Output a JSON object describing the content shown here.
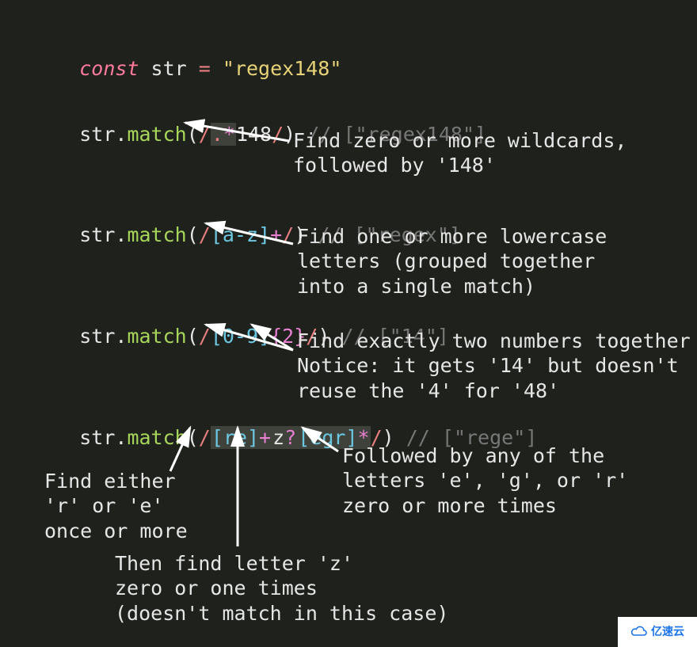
{
  "declaration": {
    "keyword": "const",
    "varname": "str",
    "equals": "=",
    "value": "\"regex148\""
  },
  "examples": [
    {
      "obj": "str",
      "method": "match",
      "pattern_parts": {
        "open": "/",
        "hl": ".*",
        "rest": "148",
        "close": "/"
      },
      "comment": "// [\"regex148\"]",
      "annotation": "Find zero or more wildcards,\nfollowed by '148'"
    },
    {
      "obj": "str",
      "method": "match",
      "pattern_parts": {
        "open": "/",
        "class": "[a-z]",
        "quant": "+",
        "close": "/"
      },
      "comment": "// [\"regex\"]",
      "annotation": "Find one or more lowercase\nletters (grouped together\ninto a single match)"
    },
    {
      "obj": "str",
      "method": "match",
      "pattern_parts": {
        "open": "/",
        "class": "[0-9]",
        "quant": "{2}",
        "close": "/"
      },
      "comment": "// [\"14\"]",
      "annotation": "Find exactly two numbers together\nNotice: it gets '14' but doesn't\nreuse the '4' for '48'"
    },
    {
      "obj": "str",
      "method": "match",
      "pattern_parts": {
        "open": "/",
        "hl1_class": "[re]",
        "hl1_quant": "+",
        "hl2_lit": "z",
        "hl2_quant": "?",
        "hl3_class": "[egr]",
        "hl3_quant": "*",
        "close": "/"
      },
      "comment": "// [\"rege\"]",
      "anno_a": "Find either\n'r' or 'e'\nonce or more",
      "anno_b": "Then find letter 'z'\nzero or one times\n(doesn't match in this case)",
      "anno_c": "Followed by any of the\nletters 'e', 'g', or 'r'\nzero or more times"
    }
  ],
  "watermark": "亿速云"
}
